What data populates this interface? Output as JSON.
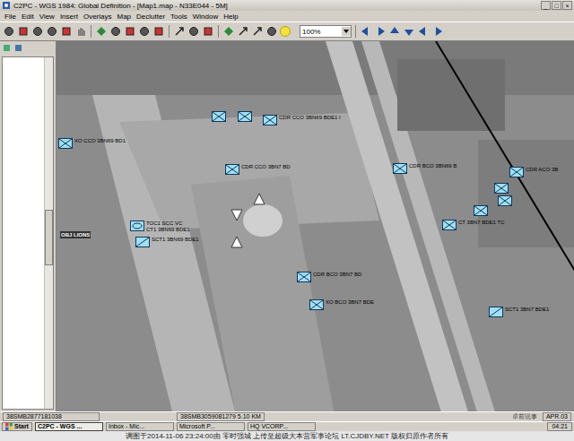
{
  "window": {
    "title": "C2PC - WGS 1984: Global Definition - [Map1.map - N33E044 - 5M]",
    "controls": [
      "_",
      "□",
      "×"
    ]
  },
  "menu": [
    "File",
    "Edit",
    "View",
    "Insert",
    "Overlays",
    "Map",
    "Declutter",
    "Tools",
    "Window",
    "Help"
  ],
  "toolbar": {
    "zoom": "100%"
  },
  "map": {
    "labels": [
      {
        "text": "OBJ LIONS"
      }
    ],
    "units": [
      {
        "kind": "infantry",
        "lines": [
          "XO CCO 3BN69 BD1"
        ]
      },
      {
        "kind": "infantry",
        "lines": []
      },
      {
        "kind": "infantry",
        "lines": []
      },
      {
        "kind": "infantry",
        "lines": [
          "CDR CCO 3BN69 BDE1 I"
        ]
      },
      {
        "kind": "infantry",
        "lines": [
          "CDR CCO 3BN7 BD"
        ]
      },
      {
        "kind": "infantry",
        "lines": [
          "CDR BCO 3BN69 B"
        ]
      },
      {
        "kind": "armor",
        "lines": [
          "TOC1 SCC VC",
          "CT1 3BN69 BDE1"
        ]
      },
      {
        "kind": "recon",
        "lines": [
          "SCT1 3BN69 BDE1"
        ]
      },
      {
        "kind": "infantry",
        "lines": [
          "CDR BCO 3BN7 BD"
        ]
      },
      {
        "kind": "infantry",
        "lines": [
          "XO BCO 3BN7 BDE"
        ]
      },
      {
        "kind": "infantry",
        "lines": [
          "CT 3BN7 BDE1 TC"
        ]
      },
      {
        "kind": "infantry",
        "lines": [
          "CDR ACO 3B"
        ]
      },
      {
        "kind": "infantry",
        "lines": []
      },
      {
        "kind": "infantry",
        "lines": []
      },
      {
        "kind": "infantry",
        "lines": []
      },
      {
        "kind": "recon",
        "lines": [
          "SCT1 3BN7 BDE1"
        ]
      }
    ],
    "control_points": [
      {
        "kind": "up"
      },
      {
        "kind": "down"
      },
      {
        "kind": "up"
      }
    ]
  },
  "status_bar": {
    "left": "38SMB2877181038",
    "middle": "38SMB3059081279  5.10 KM",
    "badge": "卓前说事",
    "right": "APR.03"
  },
  "taskbar": {
    "start": "Start",
    "items": [
      {
        "label": "C2PC - WGS ...",
        "selected": true
      },
      {
        "label": "Inbox - Mic...",
        "selected": false
      },
      {
        "label": "Microsoft P...",
        "selected": false
      },
      {
        "label": "HQ VCORP...",
        "selected": false
      }
    ],
    "clock": "04:21"
  },
  "watermark": "调图于2014-11-06 23:24:00由 零时强城 上传至超级大本营军事论坛 LT.CJDBY.NET 版权归原作者所有"
}
